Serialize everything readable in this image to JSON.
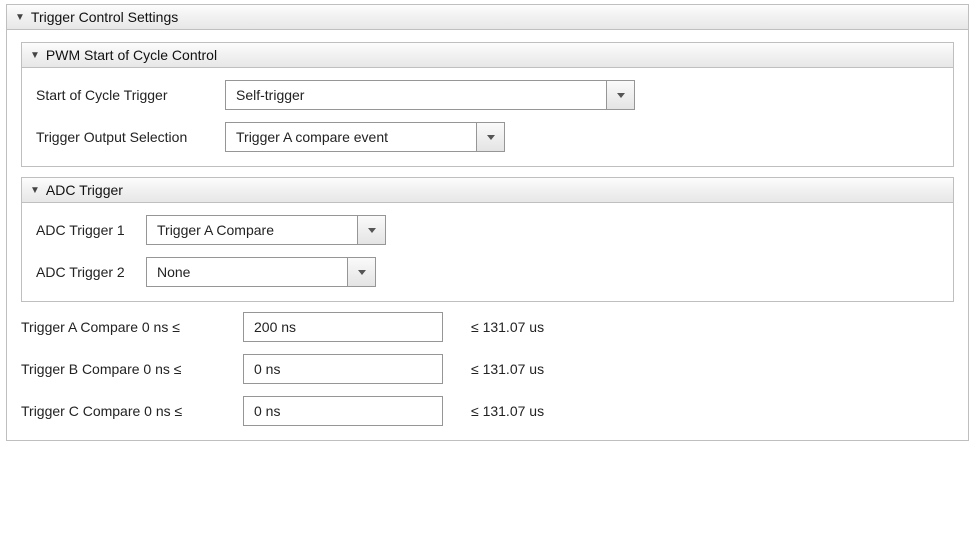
{
  "outer": {
    "title": "Trigger Control Settings"
  },
  "pwm": {
    "title": "PWM Start of Cycle Control",
    "socLabel": "Start of Cycle Trigger",
    "socValue": "Self-trigger",
    "outSelLabel": "Trigger Output Selection",
    "outSelValue": "Trigger A compare event"
  },
  "adc": {
    "title": "ADC Trigger",
    "t1Label": "ADC Trigger 1",
    "t1Value": "Trigger A Compare",
    "t2Label": "ADC Trigger 2",
    "t2Value": "None"
  },
  "compare": {
    "a": {
      "label": "Trigger A Compare  0 ns  ≤",
      "value": "200 ns",
      "max": "≤  131.07 us"
    },
    "b": {
      "label": "Trigger B Compare  0 ns  ≤",
      "value": "0 ns",
      "max": "≤  131.07 us"
    },
    "c": {
      "label": "Trigger C Compare  0 ns  ≤",
      "value": "0 ns",
      "max": "≤  131.07 us"
    }
  }
}
